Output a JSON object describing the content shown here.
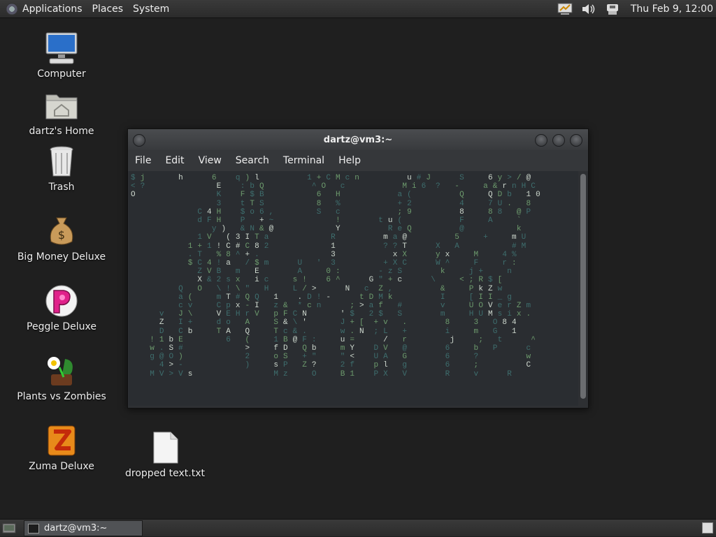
{
  "top_panel": {
    "menus": [
      "Applications",
      "Places",
      "System"
    ],
    "clock": "Thu Feb  9, 12:00",
    "tray_icons": [
      "presentation-icon",
      "volume-icon",
      "network-icon"
    ]
  },
  "desktop_icons": [
    {
      "label": "Computer",
      "icon": "computer-icon"
    },
    {
      "label": "dartz's Home",
      "icon": "home-folder-icon"
    },
    {
      "label": "Trash",
      "icon": "trash-icon"
    },
    {
      "label": "Big Money Deluxe",
      "icon": "money-bag-icon"
    },
    {
      "label": "Peggle Deluxe",
      "icon": "peggle-icon"
    },
    {
      "label": "Plants vs Zombies",
      "icon": "plants-vs-zombies-icon"
    },
    {
      "label": "Zuma Deluxe",
      "icon": "zuma-icon"
    },
    {
      "label": "dropped text.txt",
      "icon": "text-file-icon"
    }
  ],
  "terminal": {
    "title": "dartz@vm3:~",
    "menu": [
      "File",
      "Edit",
      "View",
      "Search",
      "Terminal",
      "Help"
    ],
    "screen_lines": [
      "$ j       h      6    q ) l          1 + C M c n          u # J      S     6 y > / @ ",
      "< ?               E    : b Q          ^ O   c            M i 6  ?   -     a & r n H C",
      "O                 K    F $ B           6   H            a (          Q     Q D b   1 0",
      "                  3    t T S           8   %            + 2          4     7 U .   8  ",
      "              C 4 H    $ o 6 ,         S   c            ; 9          8     8 8   @ P  ",
      "              d F H    P   + ~             !        t u (            F     A     `    ",
      "                 y )   & N & @             Y          R e Q          @           k    ",
      "              1 V   ( 3 I T a             R          m a @          5     +     m U  ",
      "            1 + 1 ! C # C 8 2             1          ? ? T      X   A           # M  ",
      "            . T   % 8 ^ + .               3            x X      y x     M     4 %  ",
      "            $ C 4 ! a   / $ m      U   '  3          + X C      W ^     F     r :   ",
      "              Z V B   m   E        A     0 :        - z S        k     j +     n    ",
      "              X & 2 s x   i c     s !    6 ^      G \" + c      \\     < ; R $ [    ",
      "          Q   O   \\ ! \\ \"   H     L / >      N   c  Z ,          &     P k Z w      ",
      "          a (     m T # Q Q   1    . D ! -      t D M k          I     [ I I _ g    ",
      "          c v     C p x - I   z &  * c n      ; > a f   #        v     U O V e r Z m",
      "      v   J \\     V E H r V   p F C N       ' $   2 $   S        m     H U M s i x .",
      "      Z   I +     d o   A     S & \\ '       J + [  + v   .        8     3   O 8 4    ",
      "      D   C b     T A   Q     T c & .       w . N  ; L   +        i     m   G   1    ",
      "    ! 1 b E         6   (     1 B @ F :     u =      /   r         j     ;   t      ^",
      "    w . S #             >     f D   Q b     m Y    D V   @        6     b   P      c",
      "    g @ O )             2     o S   + \"     \" <    U A   G        6     ?          w",
      "      4 > -             )     s P   Z ?     2 f    p l   g        6     ;          C",
      "    M V > V s                 M z     O     B 1    P X   V        R     v      R   "
    ]
  },
  "taskbar": {
    "task_label": "dartz@vm3:~"
  }
}
